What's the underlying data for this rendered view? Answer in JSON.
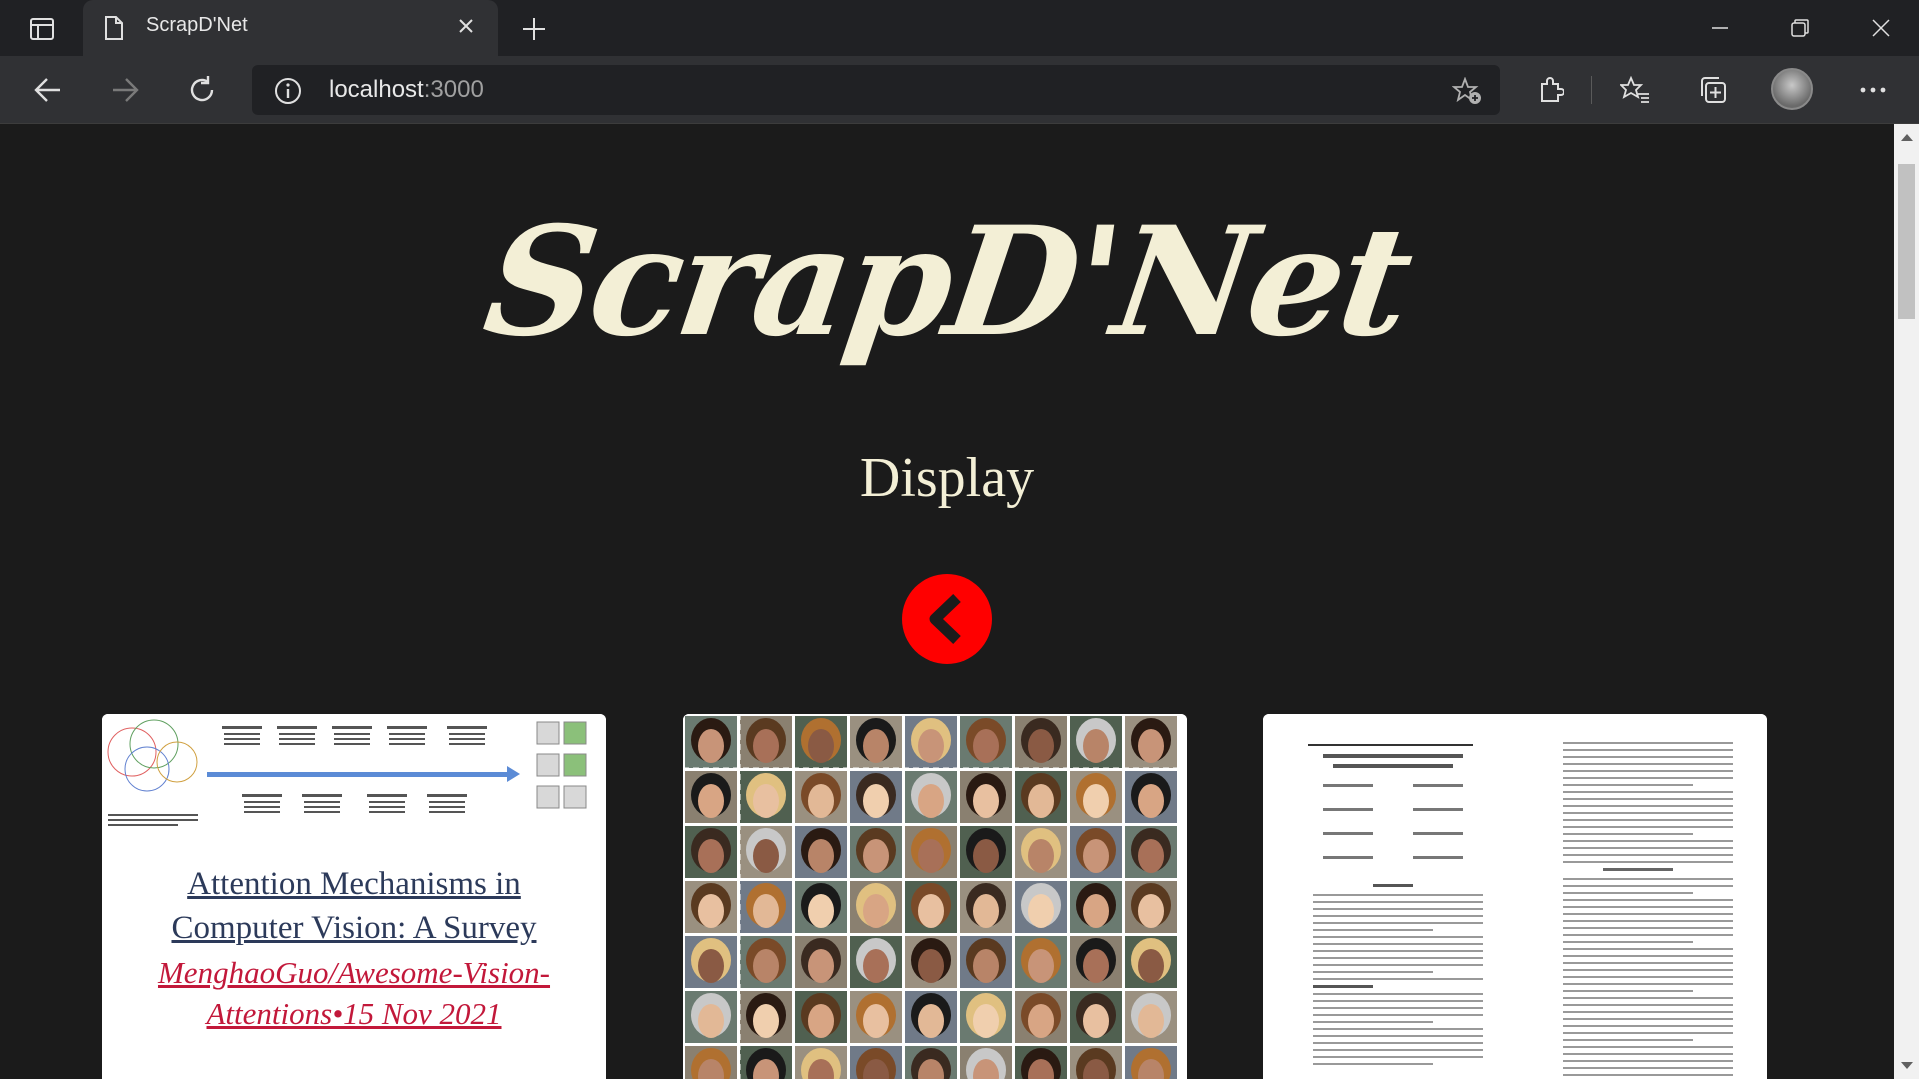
{
  "browser": {
    "tab_title": "ScrapD'Net",
    "url_host": "localhost",
    "url_port": ":3000"
  },
  "page": {
    "logo": "ScrapD'Net",
    "heading": "Display",
    "cards": [
      {
        "title": "Attention Mechanisms in Computer Vision: A Survey",
        "meta": "MenghaoGuo/Awesome-Vision-Attentions•15 Nov 2021"
      },
      {
        "title": "",
        "meta": ""
      },
      {
        "title": "",
        "meta": ""
      }
    ]
  },
  "colors": {
    "background": "#1b1b1b",
    "logo": "#f3efd6",
    "accent_red": "#ff0000",
    "link_title": "#2c3a5a",
    "link_meta": "#c2183a"
  }
}
